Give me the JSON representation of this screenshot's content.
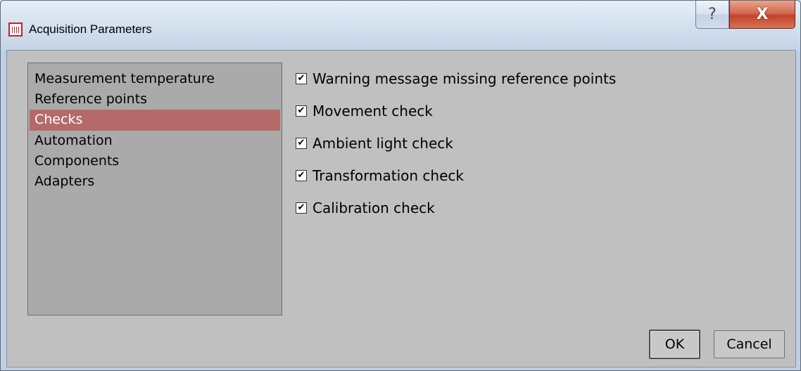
{
  "window": {
    "title": "Acquisition Parameters",
    "help_glyph": "?",
    "close_glyph": "X",
    "app_icon": "thermal-camera-icon"
  },
  "categories": {
    "items": [
      {
        "label": "Measurement temperature",
        "selected": false
      },
      {
        "label": "Reference points",
        "selected": false
      },
      {
        "label": "Checks",
        "selected": true
      },
      {
        "label": "Automation",
        "selected": false
      },
      {
        "label": "Components",
        "selected": false
      },
      {
        "label": "Adapters",
        "selected": false
      }
    ]
  },
  "checks": [
    {
      "label": "Warning message missing reference points",
      "checked": true
    },
    {
      "label": "Movement check",
      "checked": true
    },
    {
      "label": "Ambient light check",
      "checked": true
    },
    {
      "label": "Transformation check",
      "checked": true
    },
    {
      "label": "Calibration check",
      "checked": true
    }
  ],
  "buttons": {
    "ok": "OK",
    "cancel": "Cancel"
  },
  "colors": {
    "selection": "#b56a6a",
    "close_button": "#c2432a",
    "client_background": "#c0c0c0",
    "list_background": "#aaaaaa"
  }
}
